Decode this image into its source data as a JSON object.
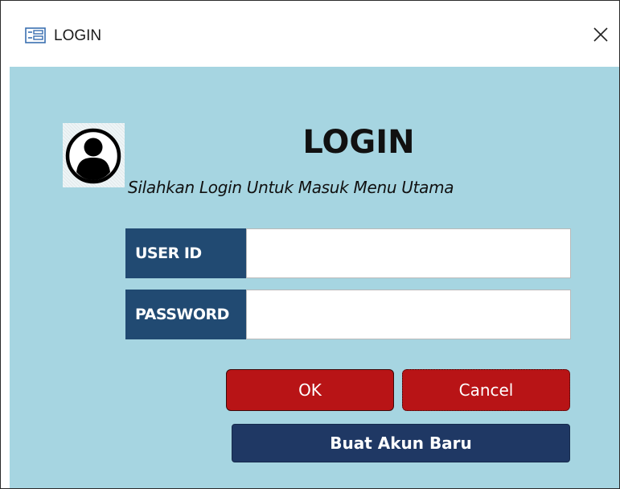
{
  "window": {
    "title": "LOGIN",
    "icon": "form-icon",
    "close_icon": "close-icon"
  },
  "form": {
    "heading": "LOGIN",
    "subtitle": "Silahkan Login Untuk Masuk Menu Utama",
    "avatar_icon": "user-avatar-icon",
    "background_color": "#a6d5e1",
    "fields": {
      "user_id": {
        "label": "USER ID",
        "value": "",
        "placeholder": ""
      },
      "password": {
        "label": "PASSWORD",
        "value": "",
        "placeholder": ""
      }
    },
    "buttons": {
      "ok": "OK",
      "cancel": "Cancel",
      "new_account": "Buat Akun Baru"
    },
    "colors": {
      "label_bg": "#214a72",
      "button_red": "#b81416",
      "button_navy": "#1f3864"
    }
  }
}
